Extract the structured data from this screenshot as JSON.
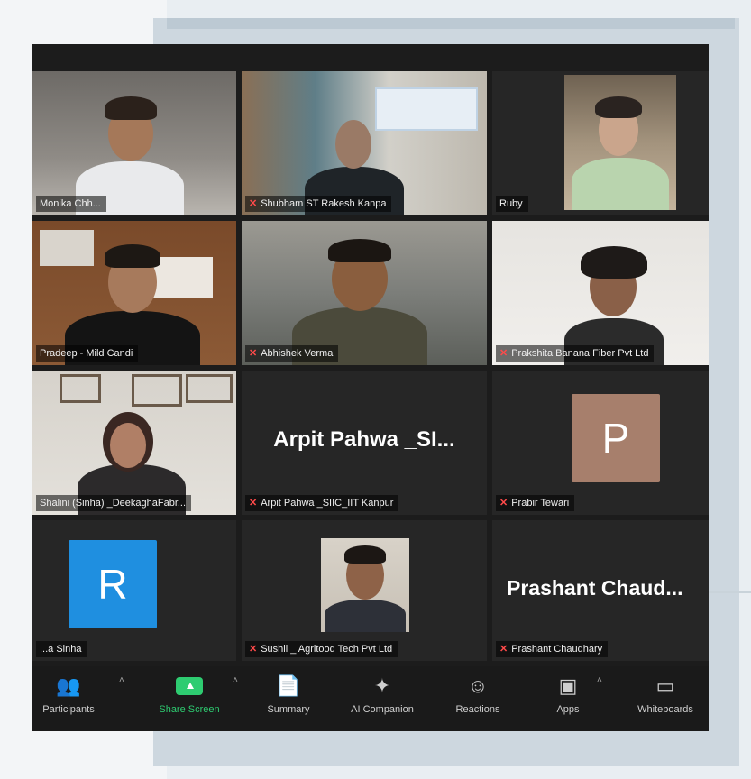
{
  "participants": [
    {
      "name": "Monika Chh..."
    },
    {
      "name": "Shubham ST Rakesh Kanpa"
    },
    {
      "name": "Ruby"
    },
    {
      "name": "Pradeep - Mild Candi"
    },
    {
      "name": "Abhishek Verma"
    },
    {
      "name": "Prakshita Banana Fiber Pvt Ltd"
    },
    {
      "name": "Shalini (Sinha) _DeekaghaFabr..."
    },
    {
      "name": "Arpit Pahwa _SIIC_IIT Kanpur",
      "display_name": "Arpit  Pahwa  _SI...",
      "avatar_letter": ""
    },
    {
      "name": "Prabir Tewari",
      "avatar_letter": "P",
      "avatar_color": "#a77f6c"
    },
    {
      "name": "...a Sinha",
      "avatar_letter": "R",
      "avatar_color": "#1f8fe0"
    },
    {
      "name": "Sushil _ Agritood Tech Pvt Ltd"
    },
    {
      "name": "Prashant Chaudhary",
      "display_name": "Prashant  Chaud..."
    }
  ],
  "toolbar": {
    "participants_label": "Participants",
    "share_label": "Share Screen",
    "summary_label": "Summary",
    "ai_label": "AI Companion",
    "reactions_label": "Reactions",
    "apps_label": "Apps",
    "whiteboards_label": "Whiteboards"
  },
  "colors": {
    "share_green": "#2ecc71",
    "mic_red": "#ff4a4a",
    "avatar_p": "#a77f6c",
    "avatar_r": "#1f8fe0"
  }
}
